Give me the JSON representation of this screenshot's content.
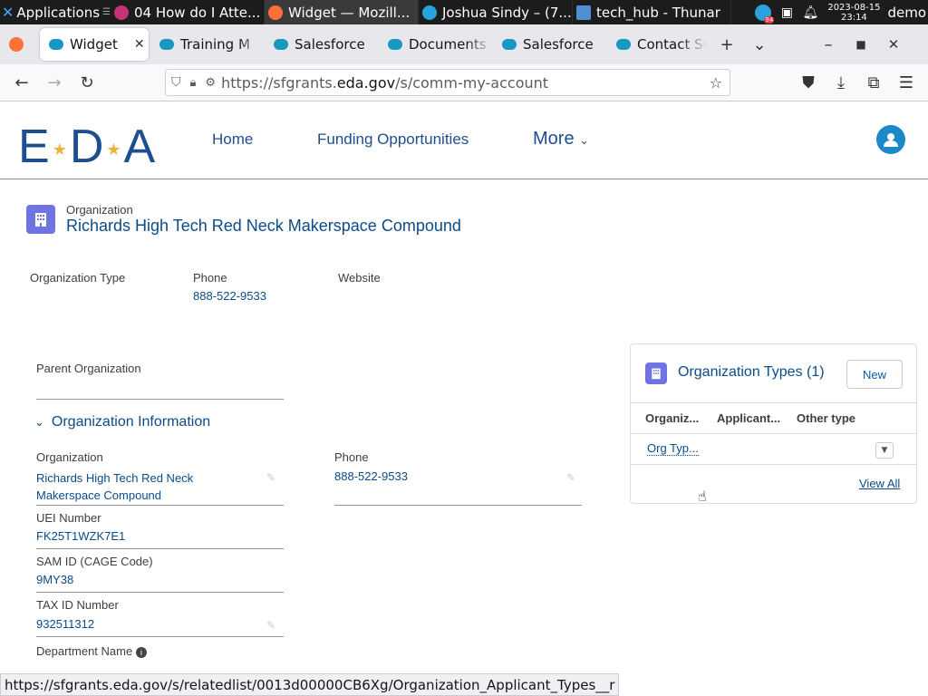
{
  "taskbar": {
    "apps_label": "Applications",
    "tasks": [
      {
        "label": "04 How do I Atte...",
        "color": "#c8327a"
      },
      {
        "label": "Widget — Mozill...",
        "color": "#ff7139"
      },
      {
        "label": "Joshua Sindy – (7...",
        "color": "#2aa2e0"
      },
      {
        "label": "tech_hub - Thunar",
        "color": "#4f8fd6"
      }
    ],
    "badge": "94",
    "date": "2023-08-15",
    "time": "23:14",
    "user": "demo"
  },
  "tabs": [
    {
      "label": "Widget"
    },
    {
      "label": "Training M"
    },
    {
      "label": "Salesforce"
    },
    {
      "label": "Documents"
    },
    {
      "label": "Salesforce"
    },
    {
      "label": "Contact Su"
    }
  ],
  "url": {
    "prefix": "https://sfgrants.",
    "domain": "eda.gov",
    "path": "/s/comm-my-account"
  },
  "site": {
    "logo_e": "E",
    "logo_d": "D",
    "logo_a": "A",
    "menu_home": "Home",
    "menu_funding": "Funding Opportunities",
    "menu_more": "More"
  },
  "record": {
    "object_label": "Organization",
    "name": "Richards High Tech Red Neck Makerspace Compound",
    "highlights": {
      "org_type_label": "Organization Type",
      "phone_label": "Phone",
      "phone_value": "888-522-9533",
      "website_label": "Website"
    }
  },
  "details": {
    "parent_label": "Parent Organization",
    "section_title": "Organization Information",
    "org_label": "Organization",
    "org_value_1": "Richards High Tech Red Neck",
    "org_value_2": "Makerspace Compound",
    "phone_label": "Phone",
    "phone_value": "888-522-9533",
    "uei_label": "UEI Number",
    "uei_value": "FK25T1WZK7E1",
    "sam_label": "SAM ID (CAGE Code)",
    "sam_value": "9MY38",
    "tax_label": "TAX ID Number",
    "tax_value": "932511312",
    "dept_label": "Department Name"
  },
  "side_card": {
    "title": "Organization Types (1)",
    "new_label": "New",
    "columns": [
      "Organiz...",
      "Applicant...",
      "Other type"
    ],
    "row_value": "Org Typ...",
    "view_all": "View All"
  },
  "status_url": "https://sfgrants.eda.gov/s/relatedlist/0013d00000CB6Xg/Organization_Applicant_Types__r"
}
